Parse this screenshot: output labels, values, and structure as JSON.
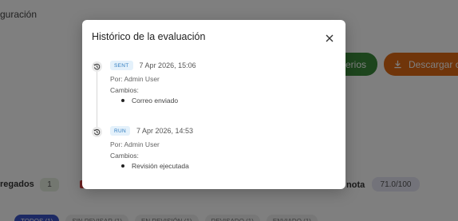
{
  "background": {
    "breadcrumb_partial": "guración",
    "criteria_button_partial": "terios",
    "download_button_partial": "Descargar ca",
    "stat_label_partial": "regados",
    "stat_count": "1",
    "grade_label_partial": "nota",
    "grade_value": "71.0/100",
    "tabs": [
      {
        "label": "TODOS (1)",
        "active": true
      },
      {
        "label": "SIN REVISAR (1)",
        "active": false
      },
      {
        "label": "EN REVISIÓN (1)",
        "active": false
      },
      {
        "label": "REVISADO (1)",
        "active": false
      },
      {
        "label": "ENVIADO (1)",
        "active": false
      }
    ],
    "colors": {
      "criteria_button": "#3a8a3a",
      "download_button": "#e06a15"
    }
  },
  "modal": {
    "title": "Histórico de la evaluación",
    "close_icon": "close-icon",
    "entries": [
      {
        "status": "SENT",
        "timestamp": "7 Apr 2026, 15:06",
        "by": "Por: Admin User",
        "changes_label": "Cambios:",
        "changes": [
          "Correo enviado"
        ],
        "icon": "history-icon"
      },
      {
        "status": "RUN",
        "timestamp": "7 Apr 2026, 14:53",
        "by": "Por: Admin User",
        "changes_label": "Cambios:",
        "changes": [
          "Revisión ejecutada"
        ],
        "icon": "history-icon"
      }
    ]
  }
}
